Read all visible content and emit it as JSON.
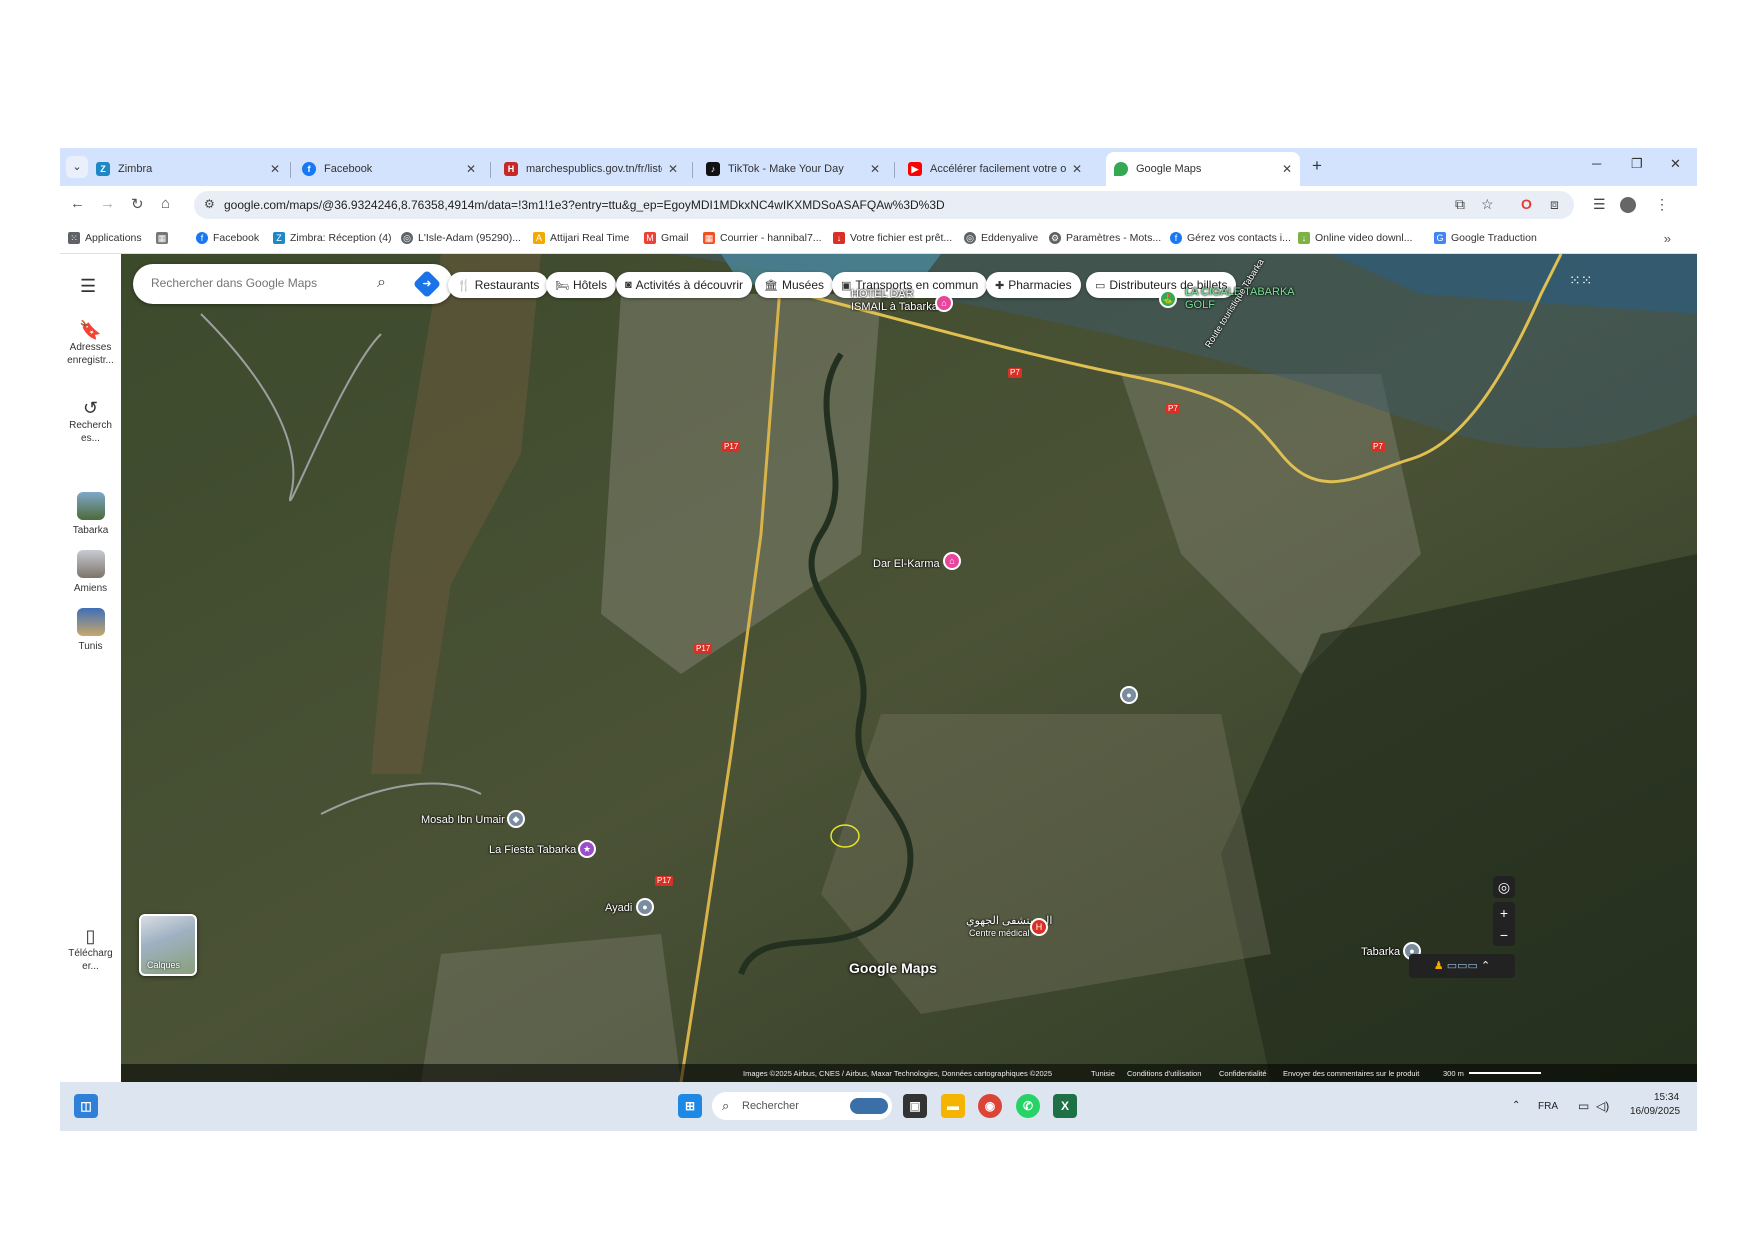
{
  "browser": {
    "tabs": [
      {
        "label": "Zimbra",
        "icon": "zimbra-icon",
        "color": "#1e88c7"
      },
      {
        "label": "Facebook",
        "icon": "facebook-icon",
        "color": "#1877f2"
      },
      {
        "label": "marchespublics.gov.tn/fr/liste-d",
        "icon": "marchespublics-icon",
        "color": "#c62828"
      },
      {
        "label": "TikTok - Make Your Day",
        "icon": "tiktok-icon",
        "color": "#111111"
      },
      {
        "label": "Accélérer facilement votre ordi",
        "icon": "youtube-icon",
        "color": "#ff0000"
      },
      {
        "label": "Google Maps",
        "icon": "maps-icon",
        "color": "#34a853"
      }
    ],
    "new_tab": "+",
    "url": "google.com/maps/@36.9324246,8.76358,4914m/data=!3m1!1e3?entry=ttu&g_ep=EgoyMDI1MDkxNC4wIKXMDSoASAFQAw%3D%3D",
    "bookmarks": [
      {
        "label": "Applications",
        "icon": "apps-grid-icon",
        "color": "#5f6368"
      },
      {
        "label": "Facebook",
        "icon": "facebook-icon",
        "color": "#1877f2"
      },
      {
        "label": "Zimbra: Réception (4)",
        "icon": "zimbra-icon",
        "color": "#1e88c7"
      },
      {
        "label": "L'Isle-Adam (95290)...",
        "icon": "globe-icon",
        "color": "#5f6368"
      },
      {
        "label": "Attijari Real Time",
        "icon": "attijari-icon",
        "color": "#f2a900"
      },
      {
        "label": "Gmail",
        "icon": "gmail-icon",
        "color": "#ea4335"
      },
      {
        "label": "Courrier - hannibal7...",
        "icon": "outlook-icon",
        "color": "#f25022"
      },
      {
        "label": "Votre fichier est prêt...",
        "icon": "file-icon",
        "color": "#d93025"
      },
      {
        "label": "Eddenyalive",
        "icon": "globe-icon",
        "color": "#5f6368"
      },
      {
        "label": "Paramètres - Mots...",
        "icon": "gear-icon",
        "color": "#5f6368"
      },
      {
        "label": "Gérez vos contacts i...",
        "icon": "facebook-icon",
        "color": "#1877f2"
      },
      {
        "label": "Online video downl...",
        "icon": "download-icon",
        "color": "#7cb342"
      },
      {
        "label": "Google Traduction",
        "icon": "translate-icon",
        "color": "#4285f4"
      }
    ]
  },
  "sidebar": {
    "items": [
      {
        "label": "Adresses enregistr...",
        "icon": "bookmark-icon"
      },
      {
        "label": "Recherch es...",
        "icon": "history-icon"
      },
      {
        "label": "Tabarka",
        "icon": "place-thumb"
      },
      {
        "label": "Amiens",
        "icon": "place-thumb"
      },
      {
        "label": "Tunis",
        "icon": "place-thumb"
      },
      {
        "label": "Télécharg er...",
        "icon": "phone-icon"
      }
    ]
  },
  "map": {
    "search_placeholder": "Rechercher dans Google Maps",
    "chips": [
      {
        "label": "Restaurants",
        "icon": "fork-knife-icon"
      },
      {
        "label": "Hôtels",
        "icon": "bed-icon"
      },
      {
        "label": "Activités à découvrir",
        "icon": "camera-icon"
      },
      {
        "label": "Musées",
        "icon": "museum-icon"
      },
      {
        "label": "Transports en commun",
        "icon": "bus-icon"
      },
      {
        "label": "Pharmacies",
        "icon": "pharmacy-icon"
      },
      {
        "label": "Distributeurs de billets",
        "icon": "atm-icon"
      }
    ],
    "places": [
      {
        "label": "HOTEL DAR ISMAIL à Tabarka",
        "color": "#e8459c"
      },
      {
        "label": "LA CIGALE TABARKA GOLF",
        "color": "#34a853"
      },
      {
        "label": "Dar El-Karma",
        "color": "#e8459c"
      },
      {
        "label": "Mosab Ibn Umair",
        "color": "#7a8ca0"
      },
      {
        "label": "La Fiesta Tabarka",
        "color": "#9c4dcc"
      },
      {
        "label": "Ayadi",
        "color": "#7a8ca0"
      },
      {
        "label": "المستشفى الجهوي",
        "sub": "Centre médical",
        "color": "#d93025"
      },
      {
        "label": "Tabarka",
        "color": "#7a8ca0"
      }
    ],
    "roads": [
      "P7",
      "P7",
      "P7",
      "P17",
      "P17",
      "P17"
    ],
    "road_sign": "Route touristique Tabarka",
    "layers_label": "Calques",
    "logo": "Google Maps",
    "attribution": {
      "imagery": "Images ©2025 Airbus, CNES / Airbus, Maxar Technologies, Données cartographiques ©2025",
      "country": "Tunisie",
      "terms": "Conditions d'utilisation",
      "privacy": "Confidentialité",
      "feedback": "Envoyer des commentaires sur le produit",
      "scale": "300 m"
    },
    "controls": {
      "zoom_in": "+",
      "zoom_out": "−"
    }
  },
  "taskbar": {
    "search_placeholder": "Rechercher",
    "language": "FRA",
    "time": "15:34",
    "date": "16/09/2025"
  }
}
